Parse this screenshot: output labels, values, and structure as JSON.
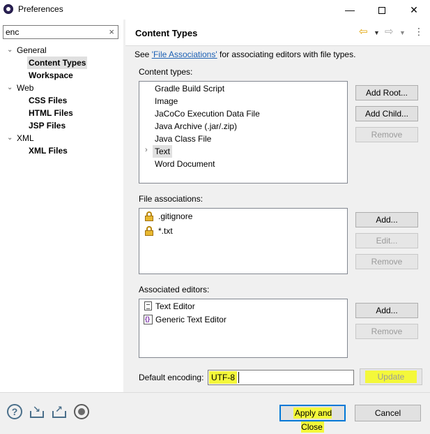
{
  "window": {
    "title": "Preferences",
    "minimize": "—",
    "close": "✕"
  },
  "colors": {
    "highlight": "#f4f83a",
    "link": "#1a5fb4",
    "focus_border": "#0078d7"
  },
  "filter": {
    "value": "enc",
    "clear_icon": "×"
  },
  "tree": {
    "items": [
      {
        "label": "General",
        "expanded": true,
        "level": 0
      },
      {
        "label": "Content Types",
        "level": 1,
        "selected": true
      },
      {
        "label": "Workspace",
        "level": 1
      },
      {
        "label": "Web",
        "expanded": true,
        "level": 0
      },
      {
        "label": "CSS Files",
        "level": 1
      },
      {
        "label": "HTML Files",
        "level": 1
      },
      {
        "label": "JSP Files",
        "level": 1
      },
      {
        "label": "XML",
        "expanded": true,
        "level": 0
      },
      {
        "label": "XML Files",
        "level": 1
      }
    ]
  },
  "page": {
    "title": "Content Types",
    "see_prefix": "See ",
    "see_link": "'File Associations'",
    "see_suffix": " for associating editors with file types.",
    "content_types_label": "Content types:",
    "content_types": [
      "Gradle Build Script",
      "Image",
      "JaCoCo Execution Data File",
      "Java Archive (.jar/.zip)",
      "Java Class File",
      "Text",
      "Word Document"
    ],
    "selected_content_type": "Text",
    "content_buttons": {
      "add_root": "Add Root...",
      "add_child": "Add Child...",
      "remove": "Remove"
    },
    "file_assoc_label": "File associations:",
    "file_associations": [
      ".gitignore",
      "*.txt"
    ],
    "file_buttons": {
      "add": "Add...",
      "edit": "Edit...",
      "remove": "Remove"
    },
    "editors_label": "Associated editors:",
    "editors": [
      "Text Editor",
      "Generic Text Editor"
    ],
    "editor_buttons": {
      "add": "Add...",
      "remove": "Remove"
    },
    "encoding_label": "Default encoding:",
    "encoding_value": "UTF-8",
    "update_label": "Update"
  },
  "bottom": {
    "apply_close": "Apply and Close",
    "cancel": "Cancel"
  },
  "icons": {
    "help": "?",
    "import": "import-icon",
    "export": "export-icon",
    "record": "record-icon"
  }
}
